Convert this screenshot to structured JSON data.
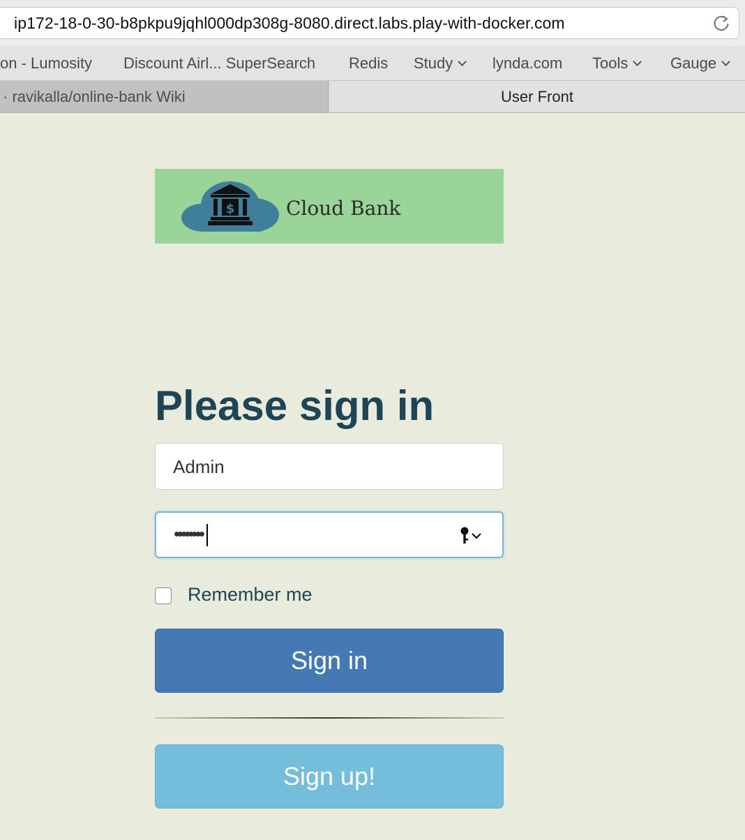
{
  "browser": {
    "url": "ip172-18-0-30-b8pkpu9jqhl000dp308g-8080.direct.labs.play-with-docker.com",
    "bookmarks": [
      {
        "label": "on - Lumosity",
        "dropdown": false
      },
      {
        "label": "Discount Airl... SuperSearch",
        "dropdown": false
      },
      {
        "label": "Redis",
        "dropdown": false
      },
      {
        "label": "Study",
        "dropdown": true
      },
      {
        "label": "lynda.com",
        "dropdown": false
      },
      {
        "label": "Tools",
        "dropdown": true
      },
      {
        "label": "Gauge",
        "dropdown": true
      }
    ],
    "tabs": [
      {
        "label": "· ravikalla/online-bank Wiki",
        "active": false
      },
      {
        "label": "User Front",
        "active": true
      }
    ]
  },
  "logo": {
    "text": "Cloud Bank"
  },
  "form": {
    "heading": "Please sign in",
    "username_value": "Admin",
    "password_masked": "••••••••",
    "remember_label": "Remember me",
    "signin_label": "Sign in",
    "signup_label": "Sign up!"
  },
  "colors": {
    "page_bg": "#e9ecdc",
    "logo_bg": "#9ad498",
    "heading": "#1e4455",
    "signin": "#4579b3",
    "signup": "#74bddb"
  }
}
